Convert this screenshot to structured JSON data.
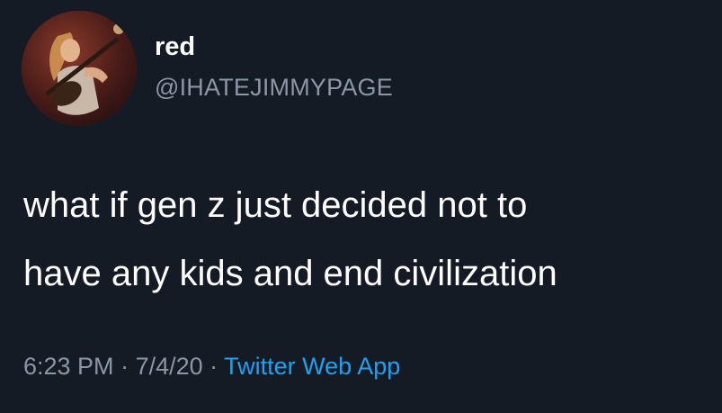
{
  "author": {
    "display_name": "red",
    "handle": "@IHATEJIMMYPAGE",
    "avatar_icon": "guitarist-photo"
  },
  "tweet": {
    "lines": [
      "what if gen z just decided not to",
      "have any kids and end civilization"
    ]
  },
  "meta": {
    "time": "6:23 PM",
    "separator": " · ",
    "date": "7/4/20",
    "source": "Twitter Web App"
  },
  "colors": {
    "background": "#151b25",
    "text": "#ffffff",
    "secondary_text": "#8c97a6",
    "link": "#1da1f2"
  }
}
